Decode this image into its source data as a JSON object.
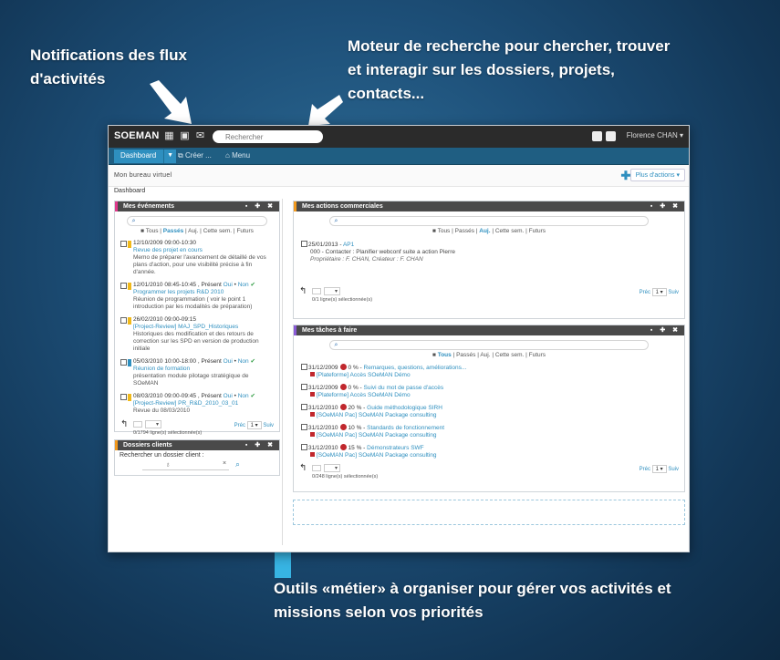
{
  "captions": {
    "notifications": "Notifications des flux d'activités",
    "search": "Moteur de recherche pour chercher, trouver et interagir sur les dossiers, projets, contacts...",
    "tools": "Outils «métier» à organiser pour gérer vos activités et missions selon vos priorités"
  },
  "topbar": {
    "logo": "SOEMAN",
    "search_placeholder": "Rechercher",
    "user": "Florence CHAN ▾"
  },
  "nav": {
    "dashboard": "Dashboard",
    "create": "Créer ...",
    "menu": "Menu"
  },
  "subbar": {
    "page_title": "Mon bureau virtuel",
    "more_actions": "Plus d'actions ▾",
    "breadcrumb": "Dashboard"
  },
  "filters": {
    "all": "Tous",
    "past": "Passés",
    "today": "Auj.",
    "week": "Cette sem.",
    "future": "Futurs"
  },
  "events_panel": {
    "title": "Mes événements",
    "items": [
      {
        "date": "12/10/2009 09:00-10:30",
        "title": "Revue des projet en cours",
        "desc": "Memo de préparer l'avancement de détaillé de vos plans d'action, pour une visibilité précise à fin d'année."
      },
      {
        "date": "12/01/2010 08:45-10:45 , Présent",
        "yes": "Oui",
        "no": "Non",
        "title": "Programmer les projets R&D 2010",
        "desc": "Réunion de programmation ( voir le point 1 introduction par les modalités de préparation)"
      },
      {
        "date": "26/02/2010 09:00-09:15",
        "title": "[Project-Review] MAJ_SPD_Historiques",
        "desc": "Historiques des modification et des retours de correction sur les SPD en version de production initiale"
      },
      {
        "date": "05/03/2010 10:00-18:00 , Présent",
        "yes": "Oui",
        "no": "Non",
        "title": "Réunion de formation",
        "desc": "présentation module pilotage stratégique de SOeMAN"
      },
      {
        "date": "08/03/2010 09:00-09:45 , Présent",
        "yes": "Oui",
        "no": "Non",
        "title": "[Project-Review] PR_R&D_2010_03_01",
        "desc": "Revue du 08/03/2010"
      }
    ],
    "count": "0/1794 ligne(s) sélectionnée(s)",
    "page_label": "Préc",
    "page_value": "1",
    "next_label": "Suiv"
  },
  "clients_panel": {
    "title": "Dossiers clients",
    "label": "Rechercher un dossier client :"
  },
  "actions_panel": {
    "title": "Mes actions commerciales",
    "item": {
      "date": "25/01/2013",
      "code": "AP1",
      "line": "000 - Contacter : Planifier webconf suite a action Pierre",
      "owner": "Propriétaire : F. CHAN, Créateur : F. CHAN"
    },
    "count": "0/1 ligne(s) sélectionnée(s)",
    "page_label": "Préc",
    "page_value": "1",
    "next_label": "Suiv"
  },
  "tasks_panel": {
    "title": "Mes tâches à faire",
    "items": [
      {
        "date": "31/12/2009",
        "pct": "0 %",
        "title": "Remarques, questions, améliorations...",
        "project": "[Plateforme] Accès SOeMAN Démo"
      },
      {
        "date": "31/12/2009",
        "pct": "0 %",
        "title": "Suivi du mot de passe d'accès",
        "project": "[Plateforme] Accès SOeMAN Démo"
      },
      {
        "date": "31/12/2010",
        "pct": "20 %",
        "title": "Guide méthodologique SIRH",
        "project": "[SOeMAN Pac] SOeMAN Package consulting"
      },
      {
        "date": "31/12/2010",
        "pct": "10 %",
        "title": "Standards de fonctionnement",
        "project": "[SOeMAN Pac] SOeMAN Package consulting"
      },
      {
        "date": "31/12/2010",
        "pct": "15 %",
        "title": "Démonstrateurs SWF",
        "project": "[SOeMAN Pac] SOeMAN Package consulting"
      }
    ],
    "count": "0/248 ligne(s) sélectionnée(s)",
    "page_label": "Préc",
    "page_value": "1",
    "next_label": "Suiv"
  },
  "colors": {
    "events_accent": "#e03a8c",
    "actions_accent": "#f39a1e",
    "tasks_accent": "#8a5bd6",
    "clients_accent": "#f39a1e",
    "brand_blue": "#2e8fbf"
  }
}
